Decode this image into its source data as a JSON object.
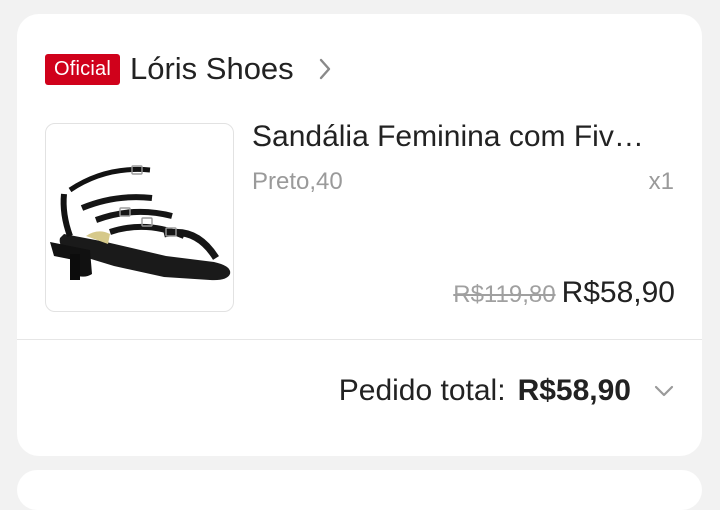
{
  "shop": {
    "badge": "Oficial",
    "name": "Lóris Shoes",
    "chevron_icon": "chevron-right-icon"
  },
  "item": {
    "image_icon": "black-strappy-sandal-image",
    "title": "Sandália Feminina com Fiv…",
    "variant": "Preto,40",
    "quantity": "x1",
    "original_price": "R$119,80",
    "price": "R$58,90"
  },
  "order": {
    "total_label": "Pedido total:",
    "total_value": "R$58,90",
    "expand_icon": "chevron-down-icon"
  },
  "colors": {
    "badge": "#d0011b",
    "text": "#222222",
    "muted": "#9a9a9a",
    "background": "#f2f2f2",
    "card": "#ffffff"
  }
}
